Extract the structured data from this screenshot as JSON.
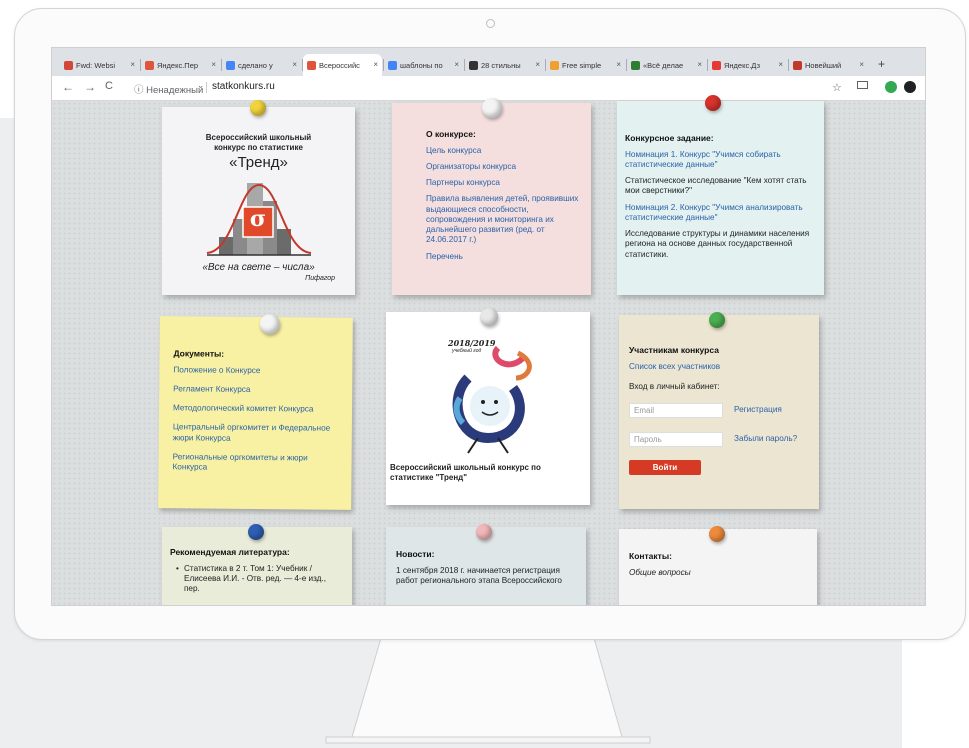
{
  "browser": {
    "tabs": [
      {
        "label": "Fwd: Websi",
        "fav_color": "#d44638"
      },
      {
        "label": "Яндекс.Пер",
        "fav_color": "#e0533c"
      },
      {
        "label": "сделано у",
        "fav_color": "#4285f4"
      },
      {
        "label": "Всероссийс",
        "fav_color": "#e0533c"
      },
      {
        "label": "шаблоны по",
        "fav_color": "#4285f4"
      },
      {
        "label": "28 стильны",
        "fav_color": "#333333"
      },
      {
        "label": "Free simple",
        "fav_color": "#f0a030"
      },
      {
        "label": "«Всё делае",
        "fav_color": "#2e7d32"
      },
      {
        "label": "Яндекс.Дз",
        "fav_color": "#e53935"
      },
      {
        "label": "Новейший",
        "fav_color": "#c0392b"
      }
    ],
    "tab_close": "×",
    "new_tab": "+",
    "nav": {
      "back": "←",
      "forward": "→",
      "reload": "C"
    },
    "security_label": "ⓘ Ненадежный",
    "url": "statkonkurs.ru",
    "star": "☆"
  },
  "notes": {
    "contest": {
      "title_line1": "Всероссийский школьный",
      "title_line2": "конкурс по статистике",
      "name": "«Тренд»",
      "logo_letter": "σ",
      "quote": "«Все на свете – числа»",
      "author": "Пифагор"
    },
    "about": {
      "heading": "О конкурсе:",
      "links": [
        "Цель конкурса",
        "Организаторы конкурса",
        "Партнеры конкурса",
        "Правила выявления детей, проявивших выдающиеся способности, сопровождения и мониторинга их дальнейшего развития (ред. от 24.06.2017 г.)",
        "Перечень"
      ]
    },
    "task": {
      "heading": "Конкурсное задание:",
      "nom1": "Номинация 1. Конкурс \"Учимся собирать статистические данные\"",
      "text1": "Статистическое исследование \"Кем хотят стать мои сверстники?\"",
      "nom2": "Номинация 2. Конкурс \"Учимся анализировать статистические данные\"",
      "text2": "Исследование структуры и динамики населения региона на основе данных государственной статистики."
    },
    "docs": {
      "heading": "Документы:",
      "links": [
        "Положение о Конкурсе",
        "Регламент Конкурса",
        "Методологический комитет Конкурса",
        "Центральный оргкомитет и Федеральное жюри Конкурса",
        "Региональные оргкомитеты и жюри Конкурса"
      ]
    },
    "poster": {
      "year": "2018/2019",
      "year_sub": "учебный год",
      "caption": "Всероссийский школьный конкурс по статистике \"Тренд\""
    },
    "participants": {
      "heading": "Участникам конкурса",
      "list_link": "Список всех участников",
      "login_label": "Вход в личный кабинет:",
      "email_placeholder": "Email",
      "register": "Регистрация",
      "password_placeholder": "Пароль",
      "forgot": "Забыли пароль?",
      "login_button": "Войти"
    },
    "literature": {
      "heading": "Рекомендуемая литература:",
      "item": "Статистика в 2 т. Том 1: Учебник / Елисеева И.И. - Отв. ред. — 4-е изд., пер."
    },
    "news": {
      "heading": "Новости:",
      "text": "1 сентября 2018 г. начинается регистрация работ регионального этапа Всероссийского"
    },
    "contacts": {
      "heading": "Контакты:",
      "subheading": "Общие вопросы"
    }
  },
  "colors": {
    "pin_yellow": "#f2d33a",
    "pin_white": "#f4f4f4",
    "pin_red": "#d9322b",
    "pin_green": "#4caf50",
    "pin_blue": "#2f5fb3",
    "pin_pink": "#f2b8b8",
    "pin_orange": "#ee8a3c",
    "login_button": "#d53b24"
  }
}
